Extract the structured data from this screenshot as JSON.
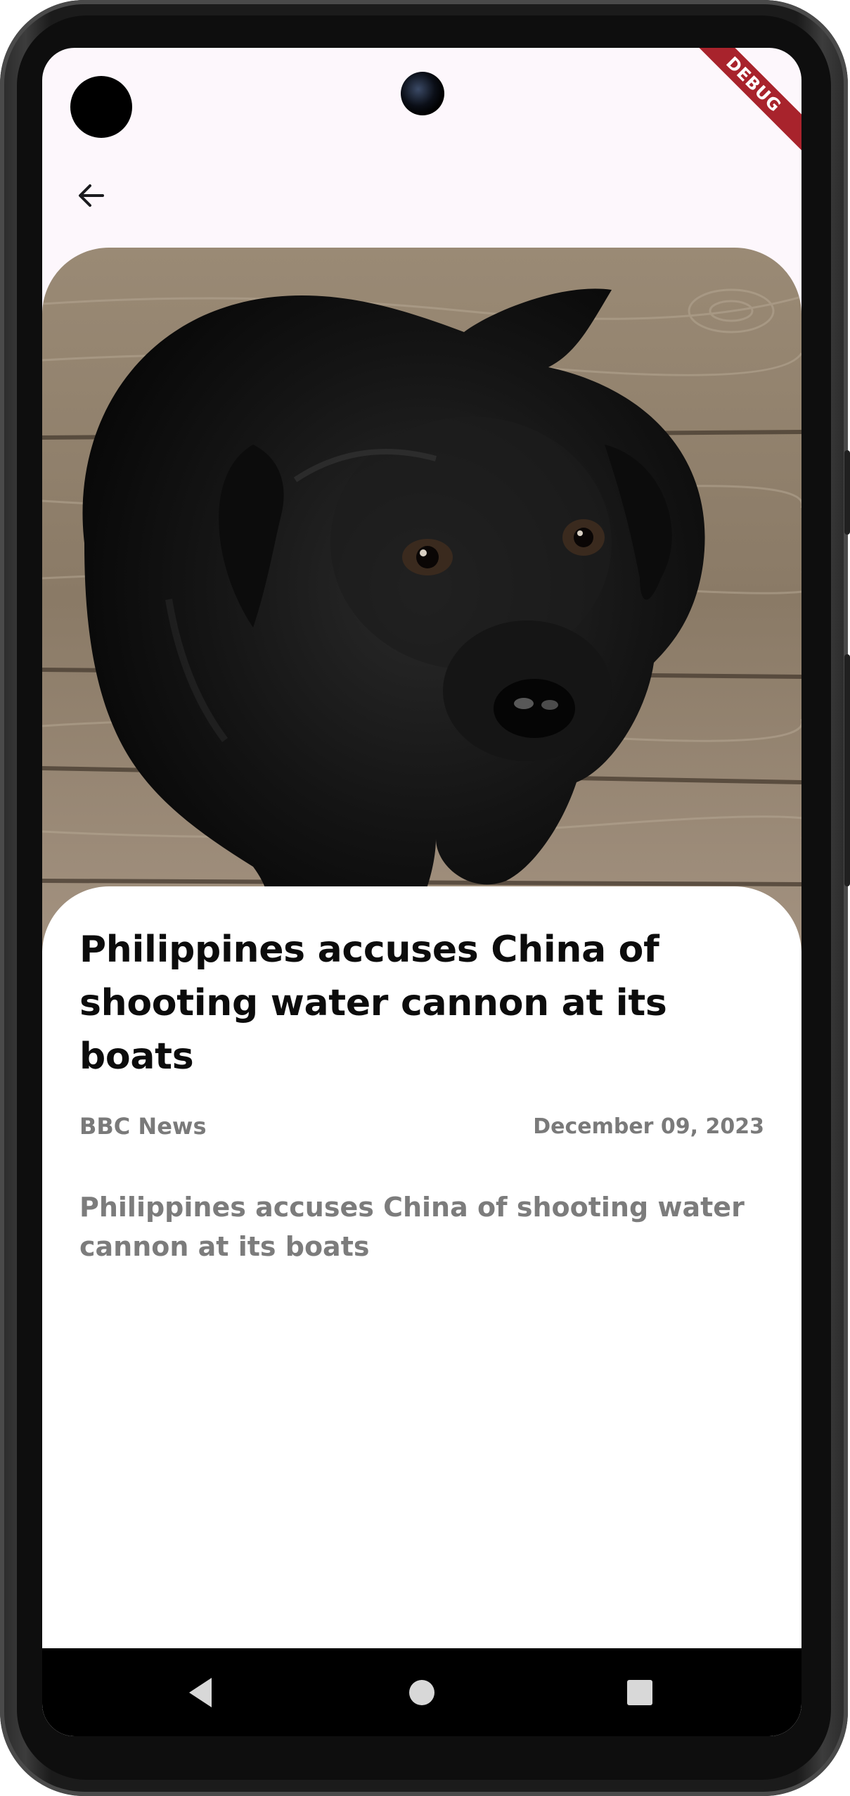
{
  "app": {
    "debug_banner": "DEBUG"
  },
  "app_bar": {
    "back_icon": "arrow-back-icon"
  },
  "article": {
    "image_subject": "black puppy sitting on wooden floor",
    "title": "Philippines accuses China of shooting water cannon at its boats",
    "source": "BBC News",
    "date": "December 09, 2023",
    "description": "Philippines accuses China of shooting water cannon at its boats"
  },
  "nav_bar": {
    "back_icon": "nav-back-icon",
    "home_icon": "nav-home-icon",
    "recents_icon": "nav-recents-icon"
  },
  "colors": {
    "screen_bg": "#fdf7fc",
    "card_bg": "#ffffff",
    "title_text": "#0c0c0c",
    "meta_text": "#7a7a7a",
    "debug_ribbon": "#a8232c",
    "nav_bar": "#000000"
  }
}
